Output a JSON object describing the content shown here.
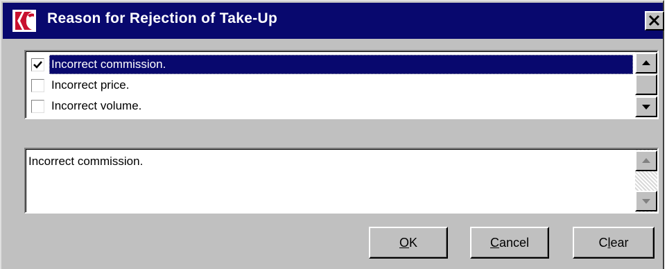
{
  "window": {
    "title": "Reason for Rejection of Take-Up",
    "app_icon": "app-logo-icon",
    "close_icon": "close-icon"
  },
  "reasons": [
    {
      "label": "Incorrect commission.",
      "checked": true,
      "selected": true
    },
    {
      "label": "Incorrect price.",
      "checked": false,
      "selected": false
    },
    {
      "label": "Incorrect volume.",
      "checked": false,
      "selected": false
    }
  ],
  "memo": {
    "text": "Incorrect commission."
  },
  "buttons": {
    "ok": {
      "mnemonic": "O",
      "rest": "K"
    },
    "cancel": {
      "mnemonic": "C",
      "rest": "ancel"
    },
    "clear": {
      "prefix": "C",
      "mnemonic": "l",
      "rest": "ear"
    }
  },
  "colors": {
    "titlebar": "#08086e",
    "face": "#c0c0c0",
    "selection": "#08086e",
    "logo_red": "#c8102e"
  }
}
